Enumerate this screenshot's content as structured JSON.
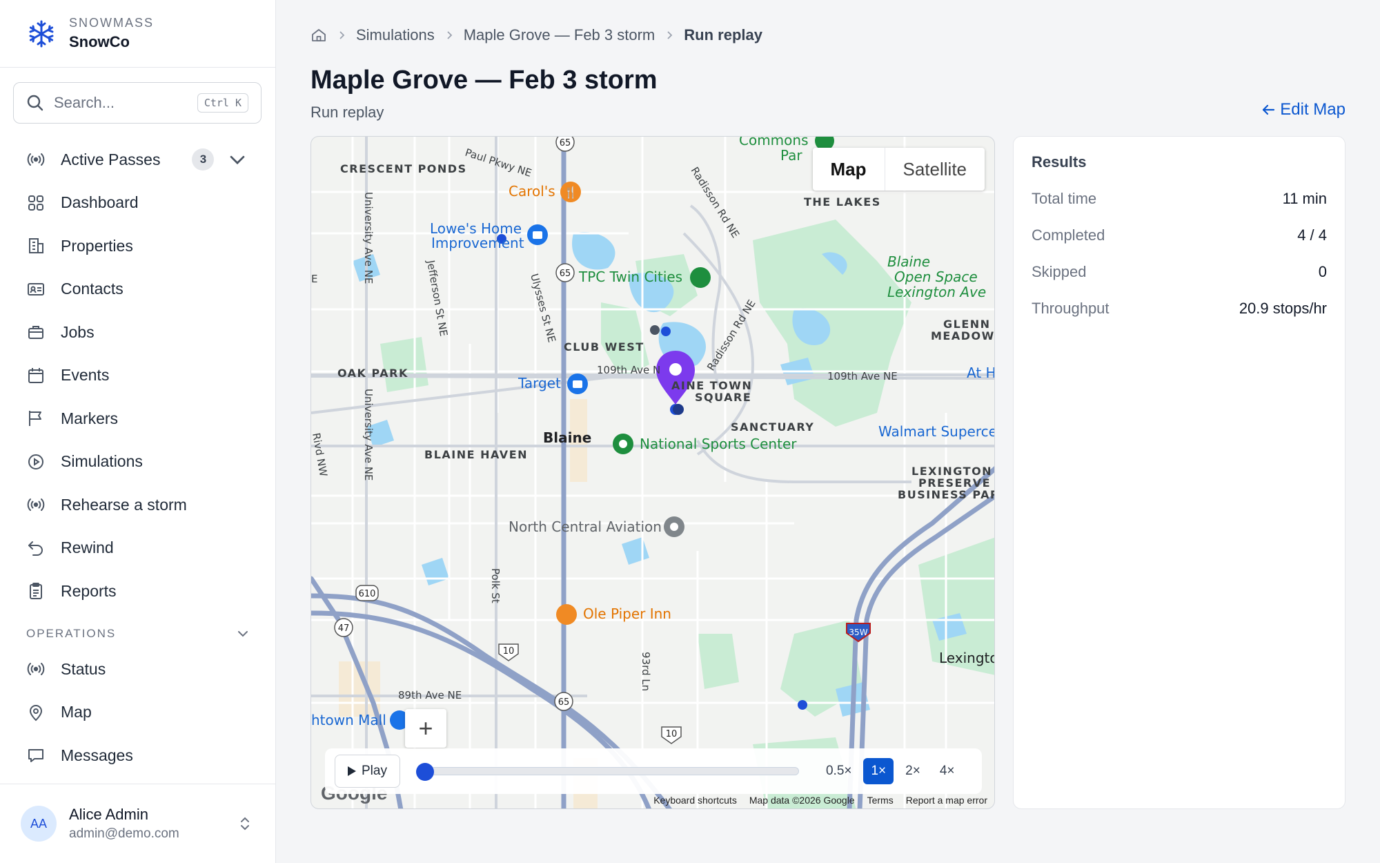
{
  "brand": {
    "org": "SNOWMASS",
    "name": "SnowCo"
  },
  "search": {
    "placeholder": "Search...",
    "shortcut": "Ctrl K"
  },
  "nav": [
    {
      "label": "Active Passes",
      "icon": "broadcast-icon",
      "badge": "3"
    },
    {
      "label": "Dashboard",
      "icon": "grid-icon"
    },
    {
      "label": "Properties",
      "icon": "building-icon"
    },
    {
      "label": "Contacts",
      "icon": "contact-card-icon"
    },
    {
      "label": "Jobs",
      "icon": "briefcase-icon"
    },
    {
      "label": "Events",
      "icon": "calendar-icon"
    },
    {
      "label": "Markers",
      "icon": "flag-icon"
    },
    {
      "label": "Simulations",
      "icon": "play-circle-icon"
    },
    {
      "label": "Rehearse a storm",
      "icon": "broadcast-icon"
    },
    {
      "label": "Rewind",
      "icon": "undo-icon"
    },
    {
      "label": "Reports",
      "icon": "clipboard-icon"
    }
  ],
  "operations": {
    "label": "OPERATIONS",
    "items": [
      {
        "label": "Status",
        "icon": "broadcast-icon"
      },
      {
        "label": "Map",
        "icon": "map-pin-icon"
      },
      {
        "label": "Messages",
        "icon": "chat-icon"
      }
    ]
  },
  "user": {
    "initials": "AA",
    "name": "Alice Admin",
    "email": "admin@demo.com"
  },
  "breadcrumb": {
    "items": [
      "Simulations",
      "Maple Grove — Feb 3 storm"
    ],
    "current": "Run replay"
  },
  "page": {
    "title": "Maple Grove — Feb 3 storm",
    "subtitle": "Run replay",
    "edit_link": "Edit Map"
  },
  "map": {
    "toggle": {
      "map": "Map",
      "satellite": "Satellite"
    },
    "zoom_in": "+",
    "labels": {
      "crescent_ponds": "CRESCENT PONDS",
      "the_lakes": "THE LAKES",
      "club_west": "CLUB WEST",
      "oak_park": "OAK PARK",
      "blaine": "Blaine",
      "blaine_haven": "BLAINE HAVEN",
      "sanctuary": "SANCTUARY",
      "blaine_town_square_1": "AINE TOWN",
      "blaine_town_square_2": "SQUARE",
      "glenn_meadows_1": "GLENN",
      "glenn_meadows_2": "MEADOWS",
      "lexington_1": "LEXINGTON",
      "lexington_2": "PRESERVE",
      "lexington_3": "BUSINESS PARK",
      "lexington_city": "Lexingto",
      "blaine_open_space_1": "Blaine",
      "blaine_open_space_2": "Open Space",
      "blaine_open_space_3": "Lexington Ave",
      "commons_1": "Commons",
      "commons_2": "Par",
      "paul_pkwy": "Paul Pkwy NE",
      "radisson_1": "Radisson Rd NE",
      "radisson_2": "Radisson Rd NE",
      "university_1": "University Ave NE",
      "university_2": "University Ave NE",
      "jefferson": "Jefferson St NE",
      "ulysses": "Ulysses St NE",
      "ave_109_a": "109th Ave N",
      "ave_109_b": "109th Ave NE",
      "ave_89": "89th Ave NE",
      "polk": "Polk St",
      "st_93": "93rd Ln",
      "rivd": "Rivd NW",
      "edge_e": "E",
      "carols": "Carol's",
      "lowes_1": "Lowe's Home",
      "lowes_2": "Improvement",
      "tpc": "TPC Twin Cities",
      "target": "Target",
      "national_sports": "National Sports Center",
      "walmart": "Walmart Superce",
      "at_h": "At H",
      "north_central": "North Central Aviation",
      "ole_piper": "Ole Piper Inn",
      "town_mall": "htown Mall",
      "hw_65": "65",
      "hw_610": "610",
      "hw_47": "47",
      "hw_10": "10",
      "hw_35w": "35W"
    },
    "google": "Google",
    "attribution": [
      "Keyboard shortcuts",
      "Map data ©2026 Google",
      "Terms",
      "Report a map error"
    ]
  },
  "replay": {
    "play_label": "Play",
    "progress": 0,
    "speeds": [
      "0.5×",
      "1×",
      "2×",
      "4×"
    ],
    "active_speed": "1×"
  },
  "results": {
    "title": "Results",
    "rows": [
      {
        "label": "Total time",
        "value": "11 min"
      },
      {
        "label": "Completed",
        "value": "4 / 4"
      },
      {
        "label": "Skipped",
        "value": "0"
      },
      {
        "label": "Throughput",
        "value": "20.9 stops/hr"
      }
    ]
  },
  "colors": {
    "accent": "#0b57d0",
    "pin": "#7c3aed",
    "stop_dot": "#1d4ed8",
    "water": "#9fd6f5",
    "park": "#c9ecd4",
    "highway": "#8fa1c7"
  }
}
